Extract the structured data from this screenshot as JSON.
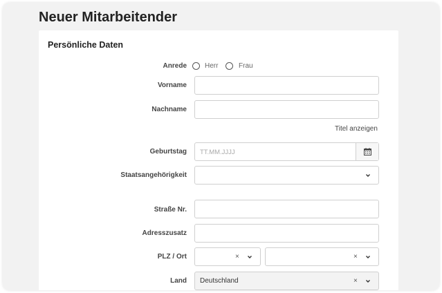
{
  "header": {
    "title": "Neuer Mitarbeitender"
  },
  "section": {
    "title": "Persönliche Daten"
  },
  "form": {
    "salutation": {
      "label": "Anrede",
      "options": [
        "Herr",
        "Frau"
      ]
    },
    "first_name": {
      "label": "Vorname",
      "value": ""
    },
    "last_name": {
      "label": "Nachname",
      "value": ""
    },
    "show_title_link": "Titel anzeigen",
    "birthday": {
      "label": "Geburtstag",
      "placeholder": "TT.MM.JJJJ",
      "icon": "calendar-icon"
    },
    "nationality": {
      "label": "Staatsangehörigkeit",
      "value": ""
    },
    "street": {
      "label": "Straße Nr.",
      "value": ""
    },
    "address_extra": {
      "label": "Adresszusatz",
      "value": ""
    },
    "zip_city": {
      "label": "PLZ / Ort"
    },
    "country": {
      "label": "Land",
      "value": "Deutschland"
    },
    "clear_glyph": "×"
  },
  "colors": {
    "page_bg": "#f2f2f2",
    "card_bg": "#ffffff",
    "border": "#cfcfcf"
  }
}
